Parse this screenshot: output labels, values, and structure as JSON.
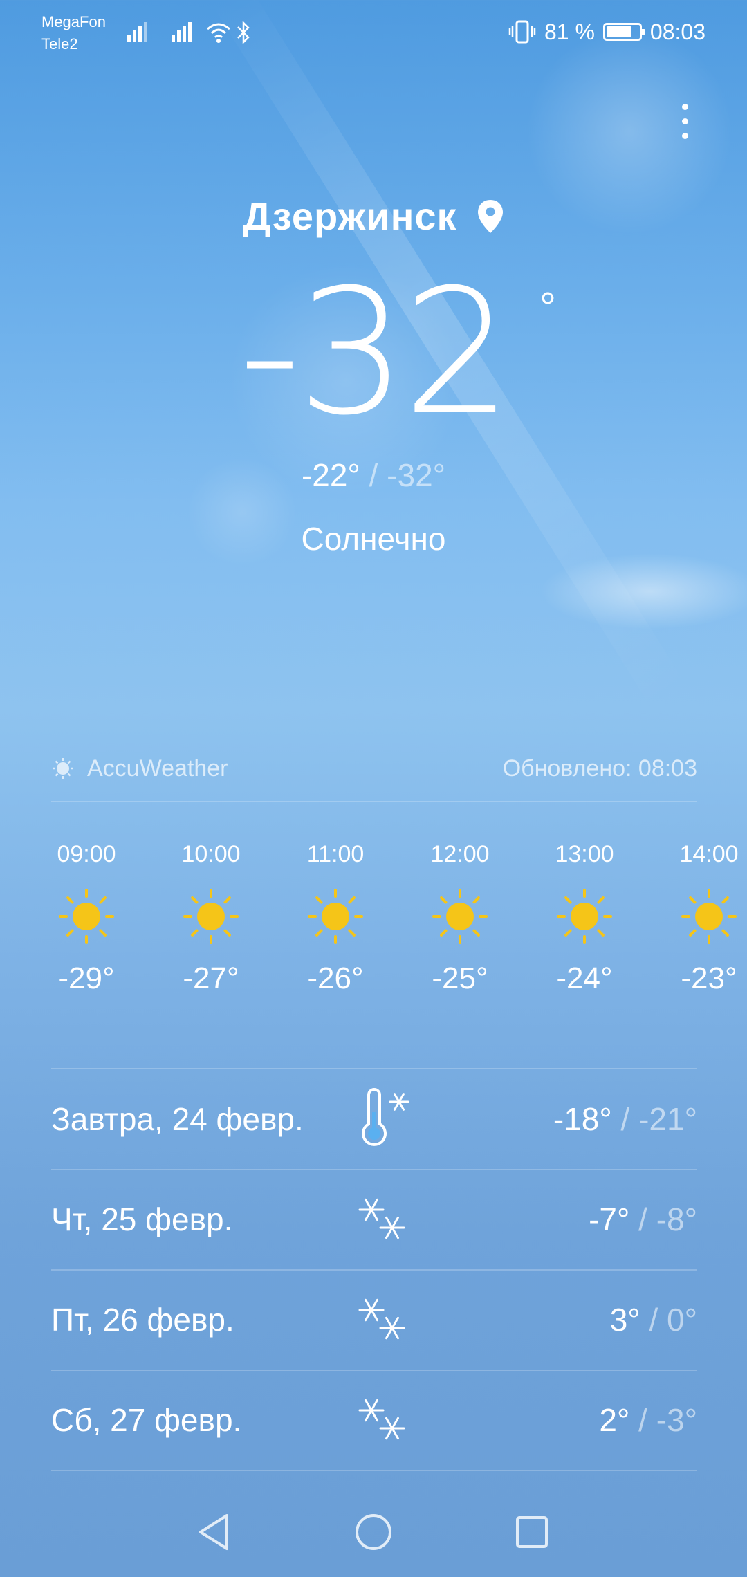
{
  "status_bar": {
    "carrier1": "MegaFon",
    "carrier2": "Tele2",
    "battery_text": "81 %",
    "battery_level": 0.81,
    "time": "08:03"
  },
  "location": {
    "city": "Дзержинск",
    "icon": "location-pin-icon"
  },
  "current": {
    "temperature": "-32",
    "degree_symbol": "°",
    "high": "-22°",
    "separator": " / ",
    "low": "-32°",
    "condition": "Солнечно"
  },
  "source": {
    "provider": "AccuWeather",
    "updated": "Обновлено: 08:03"
  },
  "hourly": [
    {
      "time": "09:00",
      "icon": "sun-icon",
      "temp": "-29°"
    },
    {
      "time": "10:00",
      "icon": "sun-icon",
      "temp": "-27°"
    },
    {
      "time": "11:00",
      "icon": "sun-icon",
      "temp": "-26°"
    },
    {
      "time": "12:00",
      "icon": "sun-icon",
      "temp": "-25°"
    },
    {
      "time": "13:00",
      "icon": "sun-icon",
      "temp": "-24°"
    },
    {
      "time": "14:00",
      "icon": "sun-icon",
      "temp": "-23°"
    }
  ],
  "daily": [
    {
      "day": "Завтра, 24 февр.",
      "icon": "cold-thermometer-icon",
      "high": "-18°",
      "separator": " / ",
      "low": "-21°"
    },
    {
      "day": "Чт, 25 февр.",
      "icon": "snow-icon",
      "high": "-7°",
      "separator": " / ",
      "low": "-8°"
    },
    {
      "day": "Пт, 26 февр.",
      "icon": "snow-icon",
      "high": "3°",
      "separator": " / ",
      "low": "0°"
    },
    {
      "day": "Сб, 27 февр.",
      "icon": "snow-icon",
      "high": "2°",
      "separator": " / ",
      "low": "-3°"
    }
  ],
  "colors": {
    "sun": "#f5c518",
    "background_top": "#4f9be0",
    "background_bottom": "#6a9ed6"
  }
}
